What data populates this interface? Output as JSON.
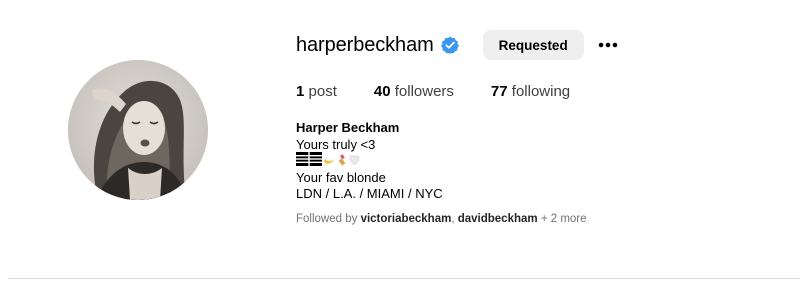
{
  "profile": {
    "username": "harperbeckham",
    "verified": true,
    "follow_button_label": "Requested",
    "more_icon": "more-horizontal-icon",
    "stats": {
      "posts_count": "1",
      "posts_label": "post",
      "followers_count": "40",
      "followers_label": "followers",
      "following_count": "77",
      "following_label": "following"
    },
    "bio": {
      "name": "Harper Beckham",
      "line1": "Yours truly <3",
      "emojis": [
        "tracks-pattern-icon",
        "crescent-moon-icon",
        "lipstick-icon",
        "white-heart-icon"
      ],
      "line3": "Your fav blonde",
      "line4": "LDN / L.A. / MIAMI / NYC"
    },
    "followed_by": {
      "prefix": "Followed by ",
      "account1": "victoriabeckham",
      "separator": ", ",
      "account2": "davidbeckham",
      "suffix": " + 2 more"
    }
  },
  "colors": {
    "verified_blue": "#3897f0",
    "button_bg": "#efefef",
    "muted_text": "#737373",
    "divider": "#dbdbdb"
  }
}
